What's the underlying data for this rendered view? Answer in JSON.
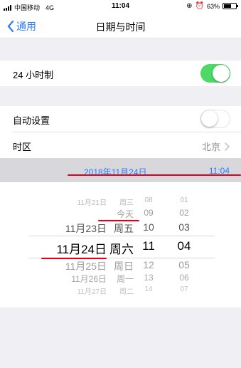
{
  "status_bar": {
    "carrier": "中国移动",
    "network": "4G",
    "time": "11:04",
    "battery": "63%",
    "battery_level": 0.63
  },
  "nav": {
    "back_label": "通用",
    "title": "日期与时间"
  },
  "settings": {
    "hour24_label": "24 小时制",
    "hour24_on": true,
    "auto_label": "自动设置",
    "auto_on": false,
    "timezone_label": "时区",
    "timezone_value": "北京"
  },
  "date_band": {
    "date": "2018年11月24日",
    "time": "11:04"
  },
  "picker": {
    "rows": [
      {
        "day": "11月21日",
        "weekday": "周三",
        "hour": "08",
        "minute": "01"
      },
      {
        "day": "",
        "weekday": "今天",
        "hour": "09",
        "minute": "02"
      },
      {
        "day": "11月23日",
        "weekday": "周五",
        "hour": "10",
        "minute": "03"
      },
      {
        "day": "11月24日",
        "weekday": "周六",
        "hour": "11",
        "minute": "04"
      },
      {
        "day": "11月25日",
        "weekday": "周日",
        "hour": "12",
        "minute": "05"
      },
      {
        "day": "11月26日",
        "weekday": "周一",
        "hour": "13",
        "minute": "06"
      },
      {
        "day": "11月27日",
        "weekday": "周二",
        "hour": "14",
        "minute": "07"
      }
    ]
  }
}
